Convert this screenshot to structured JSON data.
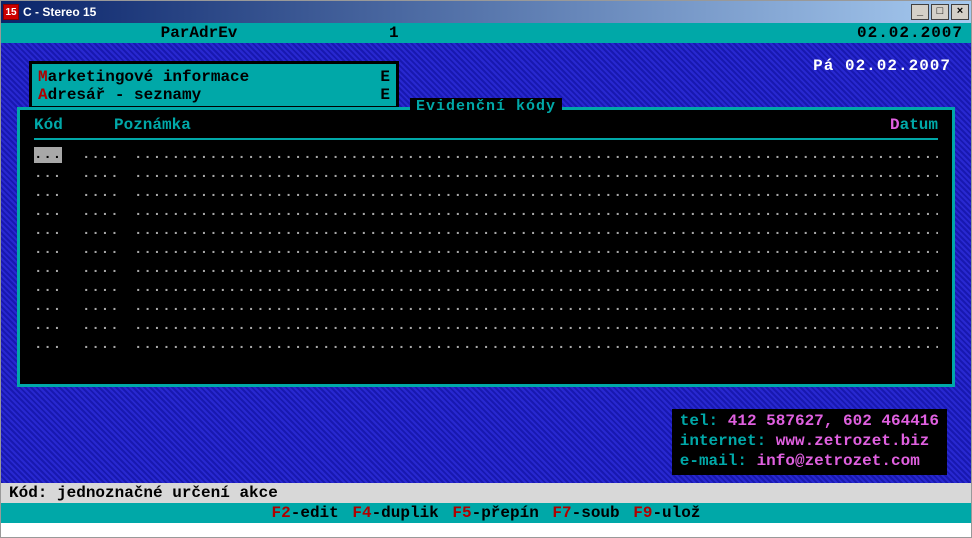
{
  "window": {
    "title": "C - Stereo 15"
  },
  "top": {
    "left": "ParAdrEv",
    "mid": "1",
    "right": "02.02.2007"
  },
  "date_header": "Pá 02.02.2007",
  "menu": {
    "items": [
      {
        "hot": "M",
        "rest": "arketingové informace",
        "flag": "E"
      },
      {
        "hot": "A",
        "rest": "dresář - seznamy",
        "flag": "E"
      }
    ]
  },
  "dialog": {
    "title": "Evidenční kódy",
    "columns": {
      "kod": "Kód",
      "poznamka": "Poznámka",
      "datum_hot": "D",
      "datum_rest": "atum"
    }
  },
  "contact": {
    "tel_label": "tel: ",
    "tel_value": "412 587627, 602 464416",
    "web_label": "internet: ",
    "web_value": "www.zetrozet.biz",
    "mail_label": "e-mail: ",
    "mail_value": "info@zetrozet.com"
  },
  "hint": "Kód: jednoznačné určení akce",
  "fkeys": {
    "f2k": "F2",
    "f2t": "-edit",
    "f4k": "F4",
    "f4t": "-duplik",
    "f5k": "F5",
    "f5t": "-přepín",
    "f7k": "F7",
    "f7t": "-soub",
    "f9k": "F9",
    "f9t": "-ulož"
  },
  "winbtns": {
    "min": "_",
    "max": "□",
    "close": "×"
  }
}
